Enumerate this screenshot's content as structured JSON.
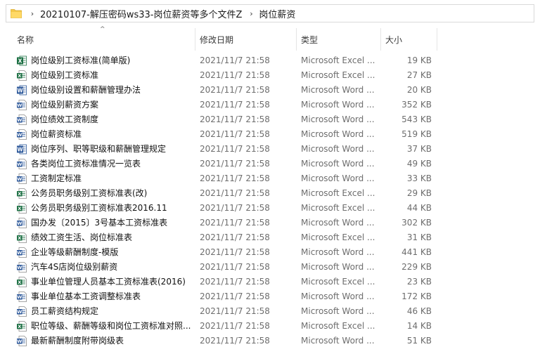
{
  "breadcrumb": {
    "folder_icon": "folder-icon",
    "separator": "›",
    "items": [
      "20210107-解压密码ws33-岗位薪资等多个文件Z",
      "岗位薪资"
    ]
  },
  "columns": {
    "name": "名称",
    "date": "修改日期",
    "type": "类型",
    "size": "大小",
    "sort_indicator": "^"
  },
  "colors": {
    "excel": "#1d7044",
    "word": "#2b579a",
    "folder": "#f4c84a"
  },
  "files": [
    {
      "name": "岗位级别工资标准(简单版)",
      "date": "2021/11/7 21:58",
      "type": "Microsoft Excel ...",
      "size": "19 KB",
      "icon": "excel"
    },
    {
      "name": "岗位级别工资标准",
      "date": "2021/11/7 21:58",
      "type": "Microsoft Excel ...",
      "size": "27 KB",
      "icon": "excel-page"
    },
    {
      "name": "岗位级别设置和薪酬管理办法",
      "date": "2021/11/7 21:58",
      "type": "Microsoft Word ...",
      "size": "20 KB",
      "icon": "word"
    },
    {
      "name": "岗位级别薪资方案",
      "date": "2021/11/7 21:58",
      "type": "Microsoft Word ...",
      "size": "352 KB",
      "icon": "word-page"
    },
    {
      "name": "岗位绩效工资制度",
      "date": "2021/11/7 21:58",
      "type": "Microsoft Word ...",
      "size": "543 KB",
      "icon": "word-page"
    },
    {
      "name": "岗位薪资标准",
      "date": "2021/11/7 21:58",
      "type": "Microsoft Word ...",
      "size": "519 KB",
      "icon": "word-page"
    },
    {
      "name": "岗位序列、职等职级和薪酬管理规定",
      "date": "2021/11/7 21:58",
      "type": "Microsoft Word ...",
      "size": "37 KB",
      "icon": "word"
    },
    {
      "name": "各类岗位工资标准情况一览表",
      "date": "2021/11/7 21:58",
      "type": "Microsoft Word ...",
      "size": "49 KB",
      "icon": "word-page"
    },
    {
      "name": "工资制定标准",
      "date": "2021/11/7 21:58",
      "type": "Microsoft Word ...",
      "size": "33 KB",
      "icon": "word-page"
    },
    {
      "name": "公务员职务级别工资标准表(改)",
      "date": "2021/11/7 21:58",
      "type": "Microsoft Excel ...",
      "size": "29 KB",
      "icon": "excel-page"
    },
    {
      "name": "公务员职务级别工资标准表2016.11",
      "date": "2021/11/7 21:58",
      "type": "Microsoft Excel ...",
      "size": "44 KB",
      "icon": "excel-page"
    },
    {
      "name": "国办发〔2015〕3号基本工资标准表",
      "date": "2021/11/7 21:58",
      "type": "Microsoft Word ...",
      "size": "302 KB",
      "icon": "word-page"
    },
    {
      "name": "绩效工资生活、岗位标准表",
      "date": "2021/11/7 21:58",
      "type": "Microsoft Excel ...",
      "size": "31 KB",
      "icon": "excel-page"
    },
    {
      "name": "企业等级薪酬制度-模版",
      "date": "2021/11/7 21:58",
      "type": "Microsoft Word ...",
      "size": "441 KB",
      "icon": "word-page"
    },
    {
      "name": "汽车4S店岗位级别薪资",
      "date": "2021/11/7 21:58",
      "type": "Microsoft Word ...",
      "size": "229 KB",
      "icon": "word-page"
    },
    {
      "name": "事业单位管理人员基本工资标准表(2016)",
      "date": "2021/11/7 21:58",
      "type": "Microsoft Excel ...",
      "size": "23 KB",
      "icon": "excel-page"
    },
    {
      "name": "事业单位基本工资调整标准表",
      "date": "2021/11/7 21:58",
      "type": "Microsoft Word ...",
      "size": "172 KB",
      "icon": "word-page"
    },
    {
      "name": "员工薪资结构规定",
      "date": "2021/11/7 21:58",
      "type": "Microsoft Word ...",
      "size": "46 KB",
      "icon": "word-page"
    },
    {
      "name": "职位等级、薪酬等级和岗位工资标准对照...",
      "date": "2021/11/7 21:58",
      "type": "Microsoft Excel ...",
      "size": "14 KB",
      "icon": "excel-page"
    },
    {
      "name": "最新薪酬制度附带岗级表",
      "date": "2021/11/7 21:58",
      "type": "Microsoft Word ...",
      "size": "51 KB",
      "icon": "word-page"
    }
  ]
}
